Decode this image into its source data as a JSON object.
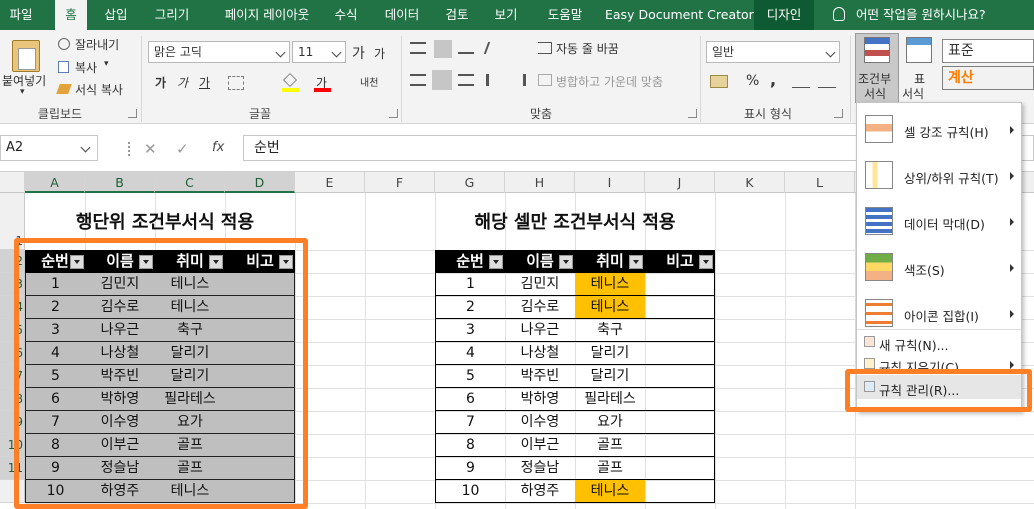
{
  "tabs": [
    "파일",
    "홈",
    "삽입",
    "그리기",
    "페이지 레이아웃",
    "수식",
    "데이터",
    "검토",
    "보기",
    "도움말",
    "Easy Document Creator",
    "디자인"
  ],
  "tell_me": "어떤 작업을 원하시나요?",
  "ribbon": {
    "clipboard": {
      "paste": "붙여넣기",
      "cut": "잘라내기",
      "copy": "복사",
      "copy_arrow": "▾",
      "format_painter": "서식 복사",
      "label": "클립보드"
    },
    "font": {
      "name": "맑은 고딕",
      "size": "11",
      "grow": "가",
      "shrink": "가",
      "bold": "가",
      "italic": "가",
      "underline": "가",
      "phonetic": "내천",
      "label": "글꼴"
    },
    "align": {
      "wrap": "자동 줄 바꿈",
      "merge": "병합하고 가운데 맞춤",
      "label": "맞춤"
    },
    "number": {
      "format": "일반",
      "percent": "%",
      "comma": ",",
      "label": "표시 형식"
    },
    "styles": {
      "cond": "조건부",
      "cond2": "서식",
      "table": "표",
      "table2": "서식",
      "style_normal": "표준",
      "style_calc": "계산"
    }
  },
  "formula_bar": {
    "name_box": "A2",
    "fx": "fx",
    "content": "순번"
  },
  "columns": [
    "A",
    "B",
    "C",
    "D",
    "E",
    "F",
    "G",
    "H",
    "I",
    "J",
    "K",
    "L"
  ],
  "rows": [
    "1",
    "2",
    "3",
    "4",
    "5",
    "6",
    "7",
    "8",
    "9",
    "10",
    "11"
  ],
  "table_left": {
    "title": "행단위 조건부서식 적용",
    "headers": [
      "순번",
      "이름",
      "취미",
      "비고"
    ],
    "rows": [
      [
        "1",
        "김민지",
        "테니스",
        ""
      ],
      [
        "2",
        "김수로",
        "테니스",
        ""
      ],
      [
        "3",
        "나우근",
        "축구",
        ""
      ],
      [
        "4",
        "나상철",
        "달리기",
        ""
      ],
      [
        "5",
        "박주빈",
        "달리기",
        ""
      ],
      [
        "6",
        "박하영",
        "필라테스",
        ""
      ],
      [
        "7",
        "이수영",
        "요가",
        ""
      ],
      [
        "8",
        "이부근",
        "골프",
        ""
      ],
      [
        "9",
        "정슬남",
        "골프",
        ""
      ],
      [
        "10",
        "하영주",
        "테니스",
        ""
      ]
    ]
  },
  "table_right": {
    "title": "해당 셀만 조건부서식 적용",
    "headers": [
      "순번",
      "이름",
      "취미",
      "비고"
    ],
    "rows": [
      [
        "1",
        "김민지",
        "테니스",
        ""
      ],
      [
        "2",
        "김수로",
        "테니스",
        ""
      ],
      [
        "3",
        "나우근",
        "축구",
        ""
      ],
      [
        "4",
        "나상철",
        "달리기",
        ""
      ],
      [
        "5",
        "박주빈",
        "달리기",
        ""
      ],
      [
        "6",
        "박하영",
        "필라테스",
        ""
      ],
      [
        "7",
        "이수영",
        "요가",
        ""
      ],
      [
        "8",
        "이부근",
        "골프",
        ""
      ],
      [
        "9",
        "정슬남",
        "골프",
        ""
      ],
      [
        "10",
        "하영주",
        "테니스",
        ""
      ]
    ],
    "highlighted_rows": [
      0,
      1,
      9
    ]
  },
  "menu": {
    "items": [
      "셀 강조 규칙(H)",
      "상위/하위 규칙(T)",
      "데이터 막대(D)",
      "색조(S)",
      "아이콘 집합(I)"
    ],
    "small": [
      "새 규칙(N)...",
      "규칙 지우기(C)",
      "규칙 관리(R)..."
    ]
  },
  "colors": {
    "excel_green": "#217346",
    "highlight": "#ffc000",
    "annotation": "#ff7f27",
    "selection_gray": "#bfbfbf"
  }
}
